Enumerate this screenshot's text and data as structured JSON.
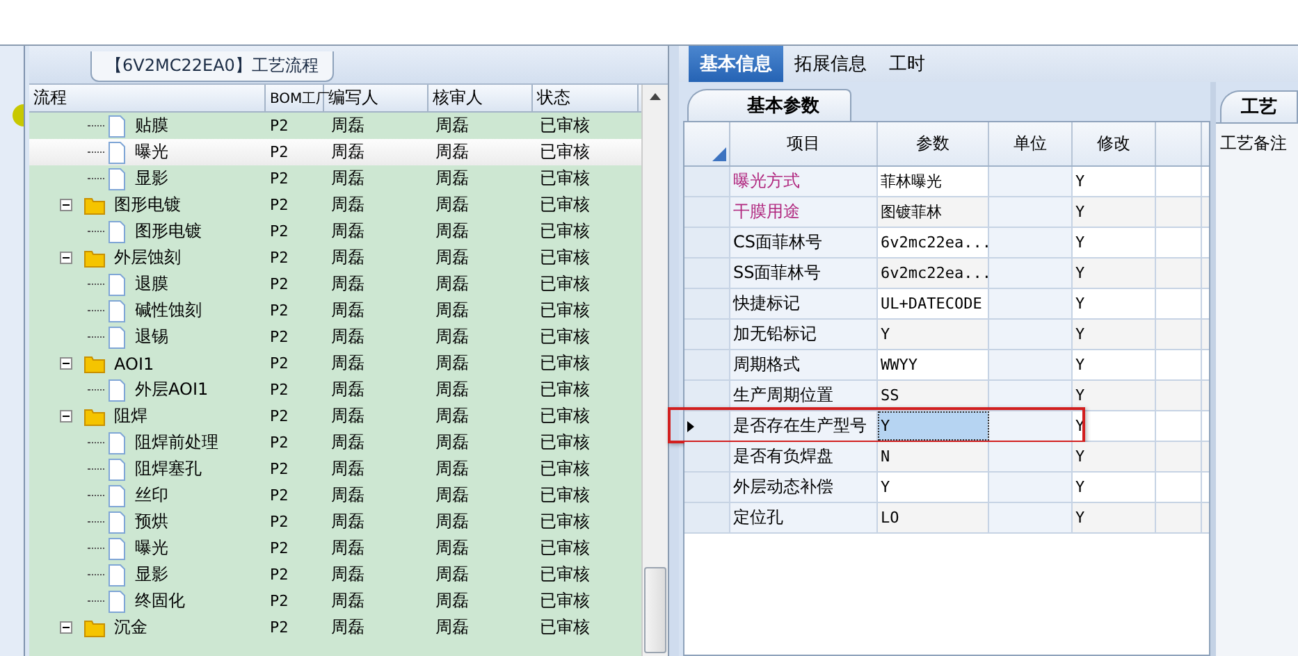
{
  "flow_panel": {
    "title": "【6V2MC22EA0】工艺流程",
    "columns": [
      "流程",
      "BOM工厂",
      "编写人",
      "核审人",
      "状态"
    ],
    "tree": [
      {
        "children": [
          {
            "label": "贴膜",
            "bom": "P2",
            "author": "周磊",
            "reviewer": "周磊",
            "status": "已审核",
            "selected": false
          },
          {
            "label": "曝光",
            "bom": "P2",
            "author": "周磊",
            "reviewer": "周磊",
            "status": "已审核",
            "selected": true
          },
          {
            "label": "显影",
            "bom": "P2",
            "author": "周磊",
            "reviewer": "周磊",
            "status": "已审核",
            "selected": false
          }
        ]
      },
      {
        "label": "图形电镀",
        "bom": "P2",
        "author": "周磊",
        "reviewer": "周磊",
        "status": "已审核",
        "selected": false,
        "expanded": true,
        "children": [
          {
            "label": "图形电镀",
            "bom": "P2",
            "author": "周磊",
            "reviewer": "周磊",
            "status": "已审核",
            "selected": false
          }
        ]
      },
      {
        "label": "外层蚀刻",
        "bom": "P2",
        "author": "周磊",
        "reviewer": "周磊",
        "status": "已审核",
        "selected": false,
        "expanded": true,
        "children": [
          {
            "label": "退膜",
            "bom": "P2",
            "author": "周磊",
            "reviewer": "周磊",
            "status": "已审核",
            "selected": false
          },
          {
            "label": "碱性蚀刻",
            "bom": "P2",
            "author": "周磊",
            "reviewer": "周磊",
            "status": "已审核",
            "selected": false
          },
          {
            "label": "退锡",
            "bom": "P2",
            "author": "周磊",
            "reviewer": "周磊",
            "status": "已审核",
            "selected": false
          }
        ]
      },
      {
        "label": "AOI1",
        "bom": "P2",
        "author": "周磊",
        "reviewer": "周磊",
        "status": "已审核",
        "selected": false,
        "expanded": true,
        "children": [
          {
            "label": "外层AOI1",
            "bom": "P2",
            "author": "周磊",
            "reviewer": "周磊",
            "status": "已审核",
            "selected": false
          }
        ]
      },
      {
        "label": "阻焊",
        "bom": "P2",
        "author": "周磊",
        "reviewer": "周磊",
        "status": "已审核",
        "selected": false,
        "expanded": true,
        "children": [
          {
            "label": "阻焊前处理",
            "bom": "P2",
            "author": "周磊",
            "reviewer": "周磊",
            "status": "已审核",
            "selected": false
          },
          {
            "label": "阻焊塞孔",
            "bom": "P2",
            "author": "周磊",
            "reviewer": "周磊",
            "status": "已审核",
            "selected": false
          },
          {
            "label": "丝印",
            "bom": "P2",
            "author": "周磊",
            "reviewer": "周磊",
            "status": "已审核",
            "selected": false
          },
          {
            "label": "预烘",
            "bom": "P2",
            "author": "周磊",
            "reviewer": "周磊",
            "status": "已审核",
            "selected": false
          },
          {
            "label": "曝光",
            "bom": "P2",
            "author": "周磊",
            "reviewer": "周磊",
            "status": "已审核",
            "selected": false
          },
          {
            "label": "显影",
            "bom": "P2",
            "author": "周磊",
            "reviewer": "周磊",
            "status": "已审核",
            "selected": false
          },
          {
            "label": "终固化",
            "bom": "P2",
            "author": "周磊",
            "reviewer": "周磊",
            "status": "已审核",
            "selected": false
          }
        ]
      },
      {
        "label": "沉金",
        "bom": "P2",
        "author": "周磊",
        "reviewer": "周磊",
        "status": "已审核",
        "selected": false,
        "expanded": true
      }
    ]
  },
  "info_panel": {
    "tabs": [
      {
        "label": "基本信息",
        "selected": true
      },
      {
        "label": "拓展信息",
        "selected": false
      },
      {
        "label": "工时",
        "selected": false
      }
    ],
    "subtab": "基本参数",
    "columns": [
      "项目",
      "参数",
      "单位",
      "修改"
    ],
    "rows": [
      {
        "item": "曝光方式",
        "value": "菲林曝光",
        "modify": "Y",
        "color": "#b0267e",
        "selected": false,
        "marked": false
      },
      {
        "item": "干膜用途",
        "value": "图镀菲林",
        "modify": "Y",
        "color": "#b0267e",
        "selected": false,
        "marked": false
      },
      {
        "item": "CS面菲林号",
        "value": "6v2mc22ea...",
        "modify": "Y",
        "color": "#000000",
        "selected": false,
        "marked": false
      },
      {
        "item": "SS面菲林号",
        "value": "6v2mc22ea...",
        "modify": "Y",
        "color": "#000000",
        "selected": false,
        "marked": false
      },
      {
        "item": "快捷标记",
        "value": "UL+DATECODE",
        "modify": "Y",
        "color": "#000000",
        "selected": false,
        "marked": false
      },
      {
        "item": "加无铅标记",
        "value": "Y",
        "modify": "Y",
        "color": "#000000",
        "selected": false,
        "marked": false
      },
      {
        "item": "周期格式",
        "value": "WWYY",
        "modify": "Y",
        "color": "#000000",
        "selected": false,
        "marked": false
      },
      {
        "item": "生产周期位置",
        "value": "SS",
        "modify": "Y",
        "color": "#000000",
        "selected": false,
        "marked": false
      },
      {
        "item": "是否存在生产型号",
        "value": "Y",
        "modify": "Y",
        "color": "#000000",
        "selected": true,
        "marked": true
      },
      {
        "item": "是否有负焊盘",
        "value": "N",
        "modify": "Y",
        "color": "#000000",
        "selected": false,
        "marked": false
      },
      {
        "item": "外层动态补偿",
        "value": "Y",
        "modify": "Y",
        "color": "#000000",
        "selected": false,
        "marked": false
      },
      {
        "item": "定位孔",
        "value": "LO",
        "modify": "Y",
        "color": "#000000",
        "selected": false,
        "marked": false
      }
    ]
  },
  "side_panel": {
    "tab": "工艺",
    "label": "工艺备注"
  }
}
